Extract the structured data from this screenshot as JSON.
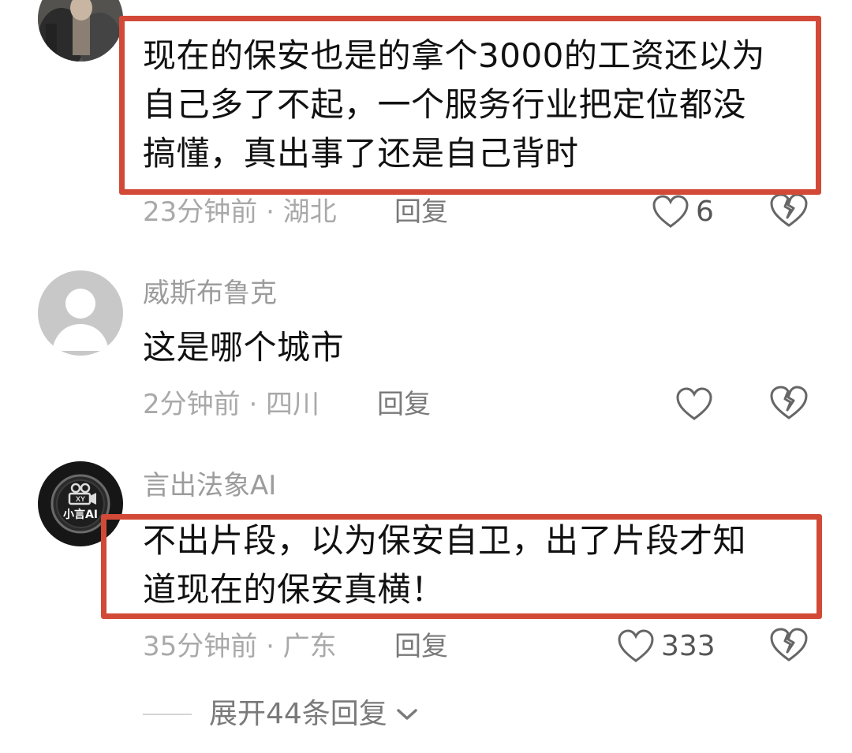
{
  "comments": [
    {
      "username": "",
      "text": "现在的保安也是的拿个3000的工资还以为\n自己多了不起，一个服务行业把定位都没\n搞懂，真出事了还是自己背时",
      "meta": "23分钟前 · 湖北",
      "reply_label": "回复",
      "likes": "6",
      "avatar_icon": "user-photo-avatar"
    },
    {
      "username": "威斯布鲁克",
      "text": "这是哪个城市",
      "meta": "2分钟前 · 四川",
      "reply_label": "回复",
      "likes": "",
      "avatar_icon": "default-user-avatar"
    },
    {
      "username": "言出法象AI",
      "text": "不出片段，以为保安自卫，出了片段才知\n道现在的保安真横！",
      "meta": "35分钟前 · 广东",
      "reply_label": "回复",
      "likes": "333",
      "avatar_icon": "xiaoyan-ai-logo-avatar"
    }
  ],
  "avatar_logo_text": "小言AI",
  "expand_replies_label": "展开44条回复",
  "colors": {
    "highlight": "#d24a37",
    "meta_text": "#a9a9a9",
    "username_text": "#9c9c9c",
    "icon_stroke": "#666666"
  },
  "icons": [
    "heart-outline-icon",
    "broken-heart-icon",
    "chevron-down-icon"
  ]
}
